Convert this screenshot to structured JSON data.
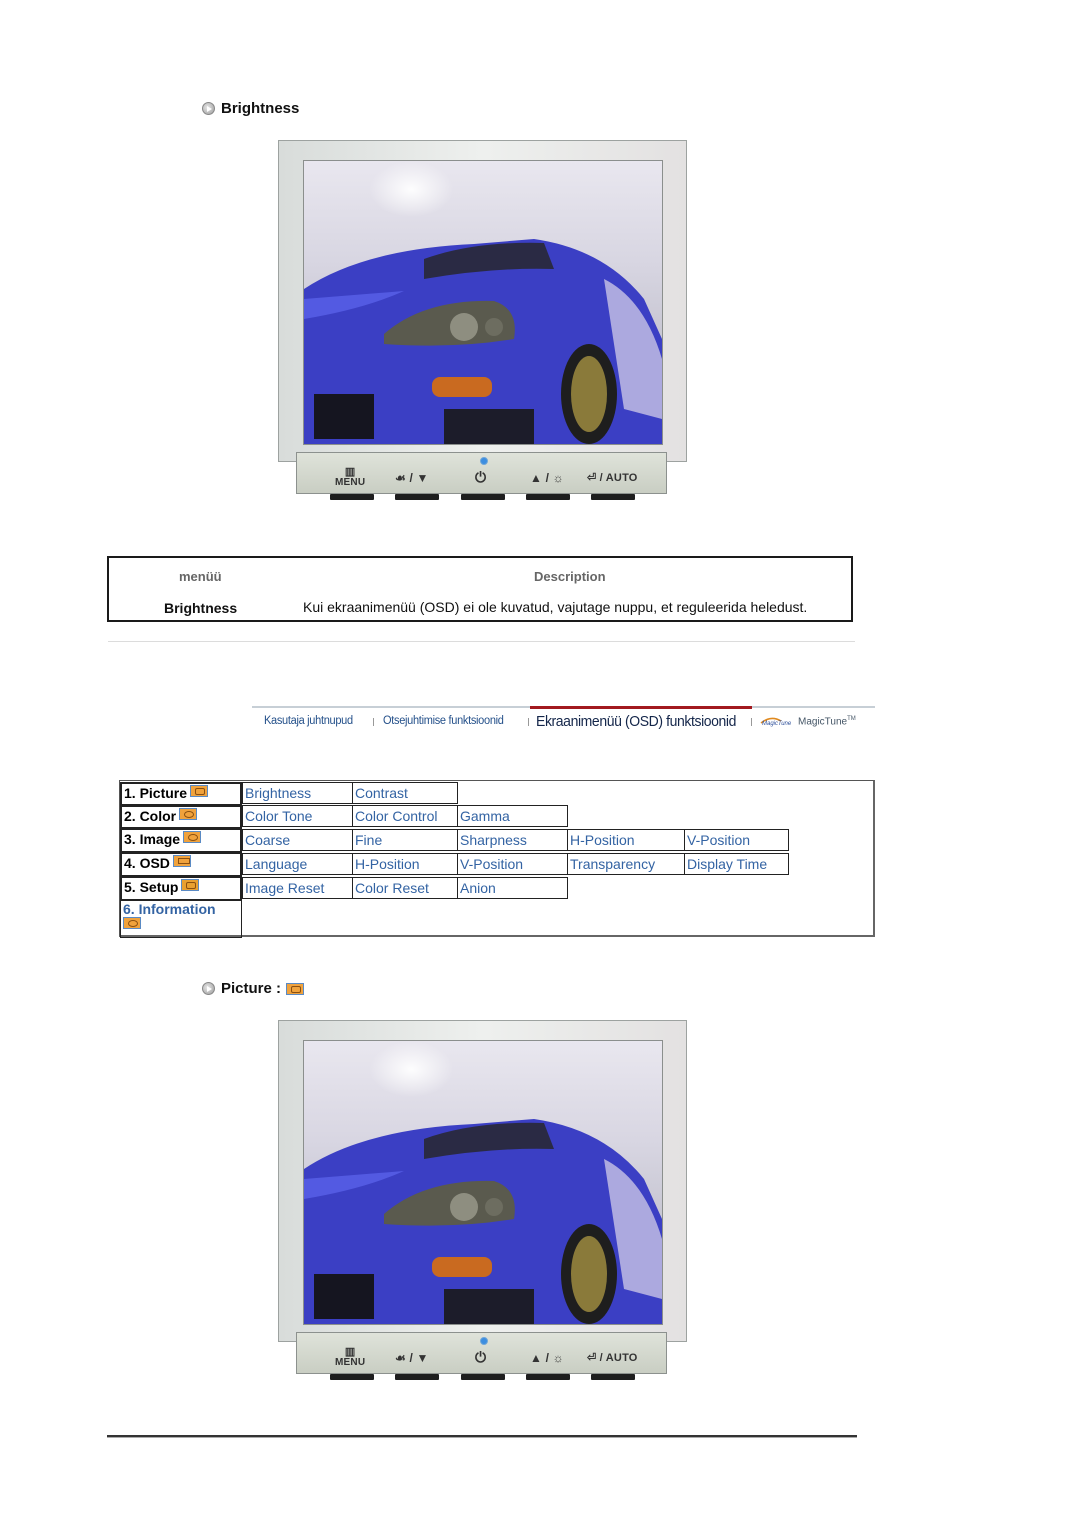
{
  "sections": {
    "brightness_title": "Brightness",
    "picture_title": "Picture :"
  },
  "monitor": {
    "buttons": [
      {
        "icon": "menu-grid-icon",
        "glyph": "▥",
        "label": "MENU"
      },
      {
        "icon": "magicbright-down-icon",
        "glyph": "",
        "label": "☙ / ▼"
      },
      {
        "icon": "power-icon",
        "glyph": "",
        "label": "⏻"
      },
      {
        "icon": "up-brightness-icon",
        "glyph": "",
        "label": "▲ / ☼"
      },
      {
        "icon": "enter-auto-icon",
        "glyph": "",
        "label": "⏎ / AUTO"
      }
    ],
    "led_color": "#3d8ee0"
  },
  "description_table": {
    "headers": [
      "menüü",
      "Description"
    ],
    "rows": [
      {
        "menu": "Brightness",
        "description": "Kui ekraanimenüü (OSD) ei ole kuvatud, vajutage nuppu, et reguleerida heledust."
      }
    ]
  },
  "navbar": {
    "items": [
      {
        "label": "Kasutaja juhtnupud",
        "active": false
      },
      {
        "label": "Otsejuhtimise funktsioonid",
        "active": false
      },
      {
        "label": "Ekraanimenüü (OSD) funktsioonid",
        "active": true
      },
      {
        "label": "MagicTune",
        "suffix": "TM",
        "active": false
      }
    ],
    "active_color": "#a2191f"
  },
  "osd_tree": {
    "menus": [
      {
        "label": "1. Picture",
        "icon": "picture-icon",
        "items": [
          "Brightness",
          "Contrast"
        ]
      },
      {
        "label": "2. Color",
        "icon": "color-icon",
        "items": [
          "Color Tone",
          "Color Control",
          "Gamma"
        ]
      },
      {
        "label": "3. Image",
        "icon": "image-icon",
        "items": [
          "Coarse",
          "Fine",
          "Sharpness",
          "H-Position",
          "V-Position"
        ]
      },
      {
        "label": "4. OSD",
        "icon": "osd-icon",
        "items": [
          "Language",
          "H-Position",
          "V-Position",
          "Transparency",
          "Display Time"
        ]
      },
      {
        "label": "5. Setup",
        "icon": "setup-icon",
        "items": [
          "Image Reset",
          "Color Reset",
          "Anion"
        ]
      },
      {
        "label": "6. Information",
        "icon": "information-icon",
        "items": []
      }
    ],
    "link_color": "#3363a3"
  }
}
